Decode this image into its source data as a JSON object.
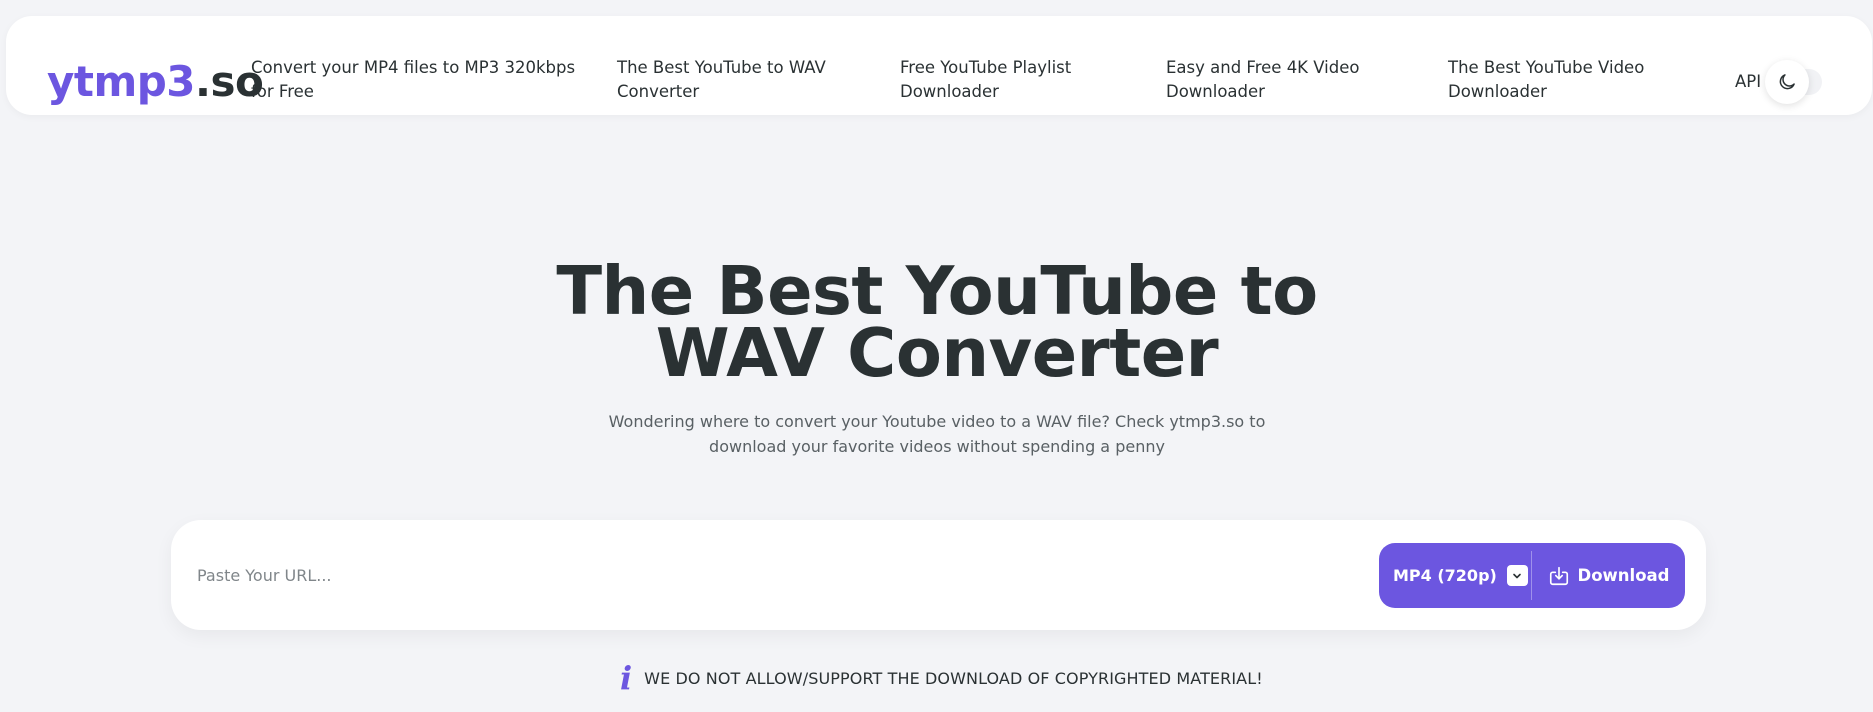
{
  "header": {
    "logo_part1": "ytmp3",
    "logo_part2": ".so",
    "nav": [
      {
        "label": "Convert your MP4 files to MP3 320kbps for Free"
      },
      {
        "label": "The Best YouTube to WAV Converter"
      },
      {
        "label": "Free YouTube Playlist Downloader"
      },
      {
        "label": "Easy and Free 4K Video Downloader"
      },
      {
        "label": "The Best YouTube Video Downloader"
      }
    ],
    "api_label": "API",
    "theme_toggle_icon": "moon-icon"
  },
  "hero": {
    "title": "The Best YouTube to WAV Converter",
    "subtitle": "Wondering where to convert your Youtube video to a WAV file? Check ytmp3.so to download your favorite videos without spending a penny"
  },
  "search": {
    "placeholder": "Paste Your URL...",
    "value": "",
    "format_label": "MP4 (720p)",
    "download_label": "Download"
  },
  "notice": {
    "icon": "info-icon",
    "text": "WE DO NOT ALLOW/SUPPORT THE DOWNLOAD OF COPYRIGHTED MATERIAL!"
  },
  "colors": {
    "accent": "#6c56e0",
    "text": "#2a3133",
    "background": "#f3f4f7",
    "surface": "#ffffff",
    "muted_text": "#596064"
  }
}
